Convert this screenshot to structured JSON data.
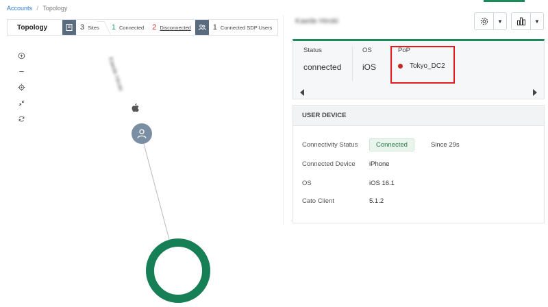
{
  "breadcrumb": {
    "accounts": "Accounts",
    "separator": "/",
    "current": "Topology"
  },
  "stats": {
    "title": "Topology",
    "sites_count": "3",
    "sites_label": "Sites",
    "connected_count": "1",
    "connected_label": "Connected",
    "disconnected_count": "2",
    "disconnected_label": "Disconnected",
    "sdp_count": "1",
    "sdp_label": "Connected SDP Users"
  },
  "topology": {
    "device_name": "Kaede Hiroki",
    "tools": [
      "zoom-in-icon",
      "zoom-out-icon",
      "center-icon",
      "collapse-icon",
      "refresh-icon"
    ]
  },
  "header": {
    "user_name": "Kaede Hiroki"
  },
  "status": {
    "status_label": "Status",
    "status_value": "connected",
    "os_label": "OS",
    "os_value": "iOS",
    "pop_label": "PoP",
    "pop_value": "Tokyo_DC2"
  },
  "user_device": {
    "section_title": "USER DEVICE",
    "connectivity_label": "Connectivity Status",
    "connectivity_value": "Connected",
    "since": "Since 29s",
    "device_label": "Connected Device",
    "device_value": "iPhone",
    "os_label": "OS",
    "os_value": "iOS 16.1",
    "client_label": "Cato Client",
    "client_value": "5.1.2"
  },
  "colors": {
    "accent_green": "#1e8a5c",
    "pop_ring": "#177f56",
    "highlight_red": "#e21c1c",
    "status_dot": "#c62828"
  }
}
